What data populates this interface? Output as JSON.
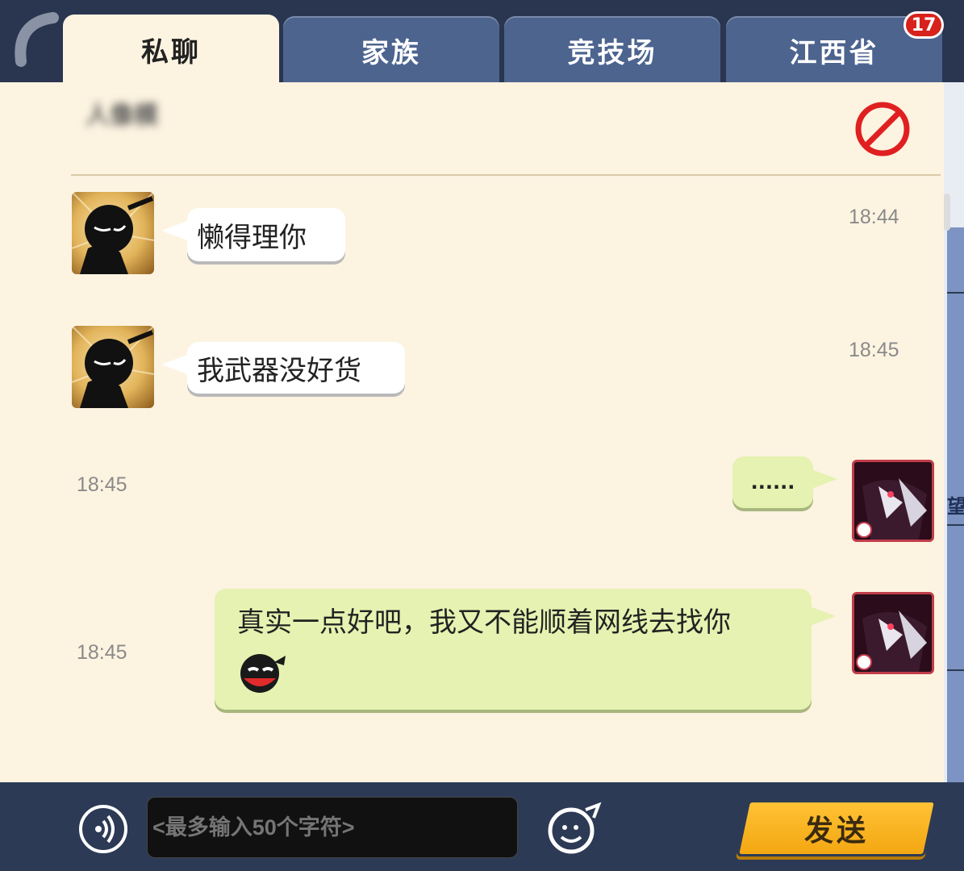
{
  "tabs": [
    {
      "label": "私聊",
      "active": true
    },
    {
      "label": "家族",
      "active": false
    },
    {
      "label": "竞技场",
      "active": false
    },
    {
      "label": "江西省",
      "active": false
    }
  ],
  "unread_badge": "17",
  "conversation": {
    "contact_name": "人像模"
  },
  "messages": [
    {
      "from": "other",
      "text": "懒得理你",
      "time": "18:44"
    },
    {
      "from": "other",
      "text": "我武器没好货",
      "time": "18:45"
    },
    {
      "from": "self",
      "text": "......",
      "time": "18:45"
    },
    {
      "from": "self",
      "text": "真实一点好吧，我又不能顺着网线去找你",
      "time": "18:45",
      "emoji": "ninja-face-emoji"
    }
  ],
  "input": {
    "placeholder": "<最多输入50个字符>",
    "value": ""
  },
  "send_label": "发送",
  "right_strip_glyph": "望",
  "icons": {
    "voice": "voice-icon",
    "emoji": "emoji-icon",
    "block": "block-icon"
  },
  "colors": {
    "panel": "#fdf3e1",
    "tab_inactive": "#4d648f",
    "send_button": "#f3a712",
    "self_bubble": "#e5f2b1",
    "badge": "#d8211b"
  }
}
